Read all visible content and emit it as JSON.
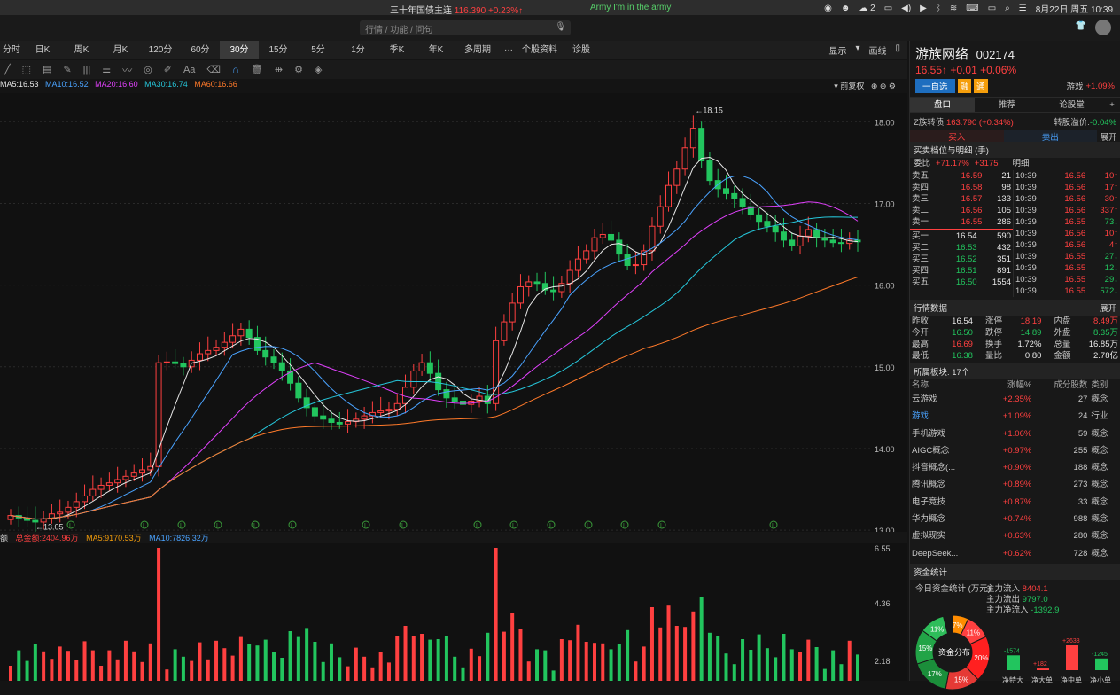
{
  "menubar": {
    "bond": "三十年国债主连",
    "bond_price": "116.390 +0.23%↑",
    "song": "Army I'm in the army",
    "badge": "2",
    "datetime": "8月22日 周五  10:39"
  },
  "search": {
    "placeholder": "行情 / 功能 / 问句"
  },
  "tabs": [
    "分时",
    "日K",
    "周K",
    "月K",
    "120分",
    "60分",
    "30分",
    "15分",
    "5分",
    "1分",
    "季K",
    "年K",
    "多周期",
    "···",
    "个股资料",
    "诊股"
  ],
  "active_tab": "30分",
  "tab_right": {
    "display": "显示",
    "draw": "画线"
  },
  "ma_legend": {
    "ma5": "MA5:16.53",
    "ma10": "MA10:16.52",
    "ma20": "MA20:16.60",
    "ma30": "MA30:16.74",
    "ma60": "MA60:16.66",
    "fuquan": "前复权"
  },
  "vol_legend": {
    "total": "总金额:2404.96万",
    "ma5": "MA5:9170.53万",
    "ma10": "MA10:7826.32万"
  },
  "chart_data": {
    "type": "candlestick",
    "yticks": [
      "18.00",
      "17.00",
      "16.00",
      "15.00",
      "14.00",
      "13.00"
    ],
    "ylim": [
      12.98,
      18.35
    ],
    "high_label": "18.15",
    "low_label": "13.05",
    "closes": [
      13.18,
      13.15,
      13.12,
      13.1,
      13.14,
      13.2,
      13.22,
      13.28,
      13.35,
      13.42,
      13.5,
      13.55,
      13.58,
      13.62,
      13.66,
      13.7,
      13.74,
      13.78,
      15.05,
      15.06,
      15.04,
      15.0,
      15.08,
      15.16,
      15.2,
      15.24,
      15.3,
      15.38,
      15.46,
      15.36,
      15.2,
      15.12,
      15.05,
      14.95,
      14.8,
      14.62,
      14.5,
      14.4,
      14.36,
      14.32,
      14.3,
      14.33,
      14.36,
      14.4,
      14.44,
      14.46,
      14.48,
      14.55,
      14.75,
      14.95,
      15.05,
      14.92,
      14.72,
      14.62,
      14.58,
      14.54,
      14.58,
      14.64,
      14.55,
      15.32,
      15.55,
      15.78,
      15.98,
      16.04,
      16.02,
      15.94,
      15.92,
      16.02,
      16.18,
      16.32,
      16.42,
      16.58,
      16.62,
      16.55,
      16.38,
      16.24,
      16.25,
      16.42,
      16.72,
      16.96,
      17.22,
      17.42,
      17.68,
      17.92,
      17.52,
      17.28,
      17.18,
      17.12,
      17.06,
      16.96,
      16.86,
      16.78,
      16.72,
      16.65,
      16.55,
      16.48,
      16.6,
      16.68,
      16.58,
      16.55,
      16.52,
      16.51,
      16.55,
      16.53
    ],
    "numbered_marks": [
      "1",
      "2",
      "3",
      "4",
      "5",
      "6",
      "7",
      "8",
      "9"
    ]
  },
  "volume_yticks": [
    "6.55",
    "4.36",
    "2.18"
  ],
  "vol_left_labels": [
    "6.55",
    "4.36",
    "2.18"
  ],
  "panel": {
    "name": "游族网络",
    "code": "002174",
    "price": "16.55↑",
    "chg": "+0.01",
    "pct": "+0.06%",
    "btn_add": "一自选",
    "tag1": "融",
    "tag2": "通",
    "sector": "游戏",
    "sector_pct": "+1.09%",
    "tabs": [
      "盘口",
      "推荐",
      "论股堂"
    ],
    "cb_name": "Z族转债:",
    "cb_val": "163.790 (+0.34%)",
    "premium_label": "转股溢价:",
    "premium": "-0.04%",
    "buy": "买入",
    "sell": "卖出",
    "expand": "展开",
    "depth_title": "买卖档位与明细 (手)",
    "weibi_label": "委比",
    "weibi": "+71.17%",
    "weicha": "+3175",
    "detail": "明细",
    "asks": [
      [
        "卖五",
        "16.59",
        "21"
      ],
      [
        "卖四",
        "16.58",
        "98"
      ],
      [
        "卖三",
        "16.57",
        "133"
      ],
      [
        "卖二",
        "16.56",
        "105"
      ],
      [
        "卖一",
        "16.55",
        "286"
      ]
    ],
    "bids": [
      [
        "买一",
        "16.54",
        "590"
      ],
      [
        "买二",
        "16.53",
        "432"
      ],
      [
        "买三",
        "16.52",
        "351"
      ],
      [
        "买四",
        "16.51",
        "891"
      ],
      [
        "买五",
        "16.50",
        "1554"
      ]
    ],
    "ticks": [
      [
        "10:39",
        "16.56",
        "10↑"
      ],
      [
        "10:39",
        "16.56",
        "17↑"
      ],
      [
        "10:39",
        "16.56",
        "30↑"
      ],
      [
        "10:39",
        "16.56",
        "337↑"
      ],
      [
        "10:39",
        "16.55",
        "73↓"
      ],
      [
        "10:39",
        "16.56",
        "10↑"
      ],
      [
        "10:39",
        "16.56",
        "4↑"
      ],
      [
        "10:39",
        "16.55",
        "27↓"
      ],
      [
        "10:39",
        "16.55",
        "12↓"
      ],
      [
        "10:39",
        "16.55",
        "29↓"
      ],
      [
        "10:39",
        "16.55",
        "572↓"
      ]
    ],
    "stats_title": "行情数据",
    "stats": [
      [
        "昨收",
        "16.54",
        "涨停",
        "18.19",
        "内盘",
        "8.49万"
      ],
      [
        "今开",
        "16.50",
        "跌停",
        "14.89",
        "外盘",
        "8.35万"
      ],
      [
        "最高",
        "16.69",
        "换手",
        "1.72%",
        "总量",
        "16.85万"
      ],
      [
        "最低",
        "16.38",
        "量比",
        "0.80",
        "金额",
        "2.78亿"
      ]
    ],
    "plates_title": "所属板块: 17个",
    "plate_headers": [
      "名称",
      "涨幅%",
      "成分股数",
      "类别"
    ],
    "plates": [
      [
        "云游戏",
        "+2.35%",
        "27",
        "概念"
      ],
      [
        "游戏",
        "+1.09%",
        "24",
        "行业"
      ],
      [
        "手机游戏",
        "+1.06%",
        "59",
        "概念"
      ],
      [
        "AIGC概念",
        "+0.97%",
        "255",
        "概念"
      ],
      [
        "抖音概念(...",
        "+0.90%",
        "188",
        "概念"
      ],
      [
        "腾讯概念",
        "+0.89%",
        "273",
        "概念"
      ],
      [
        "电子竞技",
        "+0.87%",
        "33",
        "概念"
      ],
      [
        "华为概念",
        "+0.74%",
        "988",
        "概念"
      ],
      [
        "虚拟现实",
        "+0.63%",
        "280",
        "概念"
      ],
      [
        "DeepSeek...",
        "+0.62%",
        "728",
        "概念"
      ]
    ],
    "fund_title": "资金统计",
    "fund_today": "今日资金统计 (万元):",
    "in_label": "主力流入",
    "in_val": "8404.1",
    "out_label": "主力流出",
    "out_val": "9797.0",
    "net_label": "主力净流入",
    "net_val": "-1392.9",
    "pie_center": "资金分布",
    "pie_labels": [
      "7%",
      "11%",
      "20%",
      "15%",
      "17%",
      "15%",
      "11%"
    ],
    "bars": [
      [
        "-1574",
        "净特大"
      ],
      [
        "+182",
        "净大单"
      ],
      [
        "+2638",
        "净中单"
      ],
      [
        "-1245",
        "净小单"
      ]
    ]
  }
}
